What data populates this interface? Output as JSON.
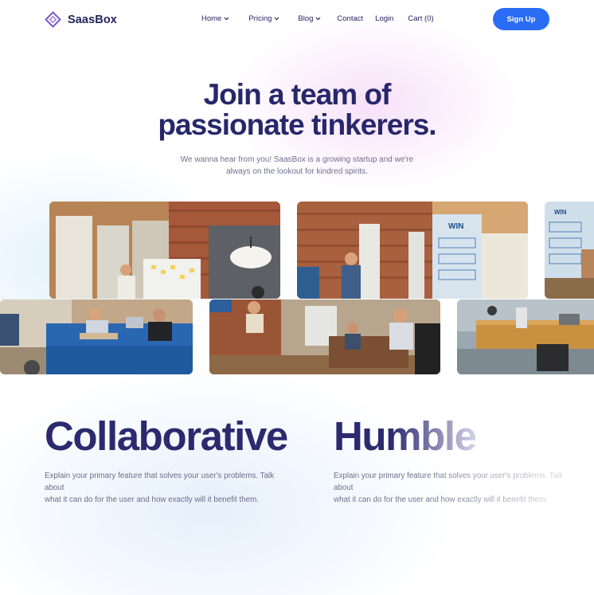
{
  "brand": {
    "name": "SaasBox",
    "accent": "#2a6df4",
    "text_color": "#27276b"
  },
  "nav": {
    "items": [
      {
        "label": "Home",
        "dropdown": true
      },
      {
        "label": "Pricing",
        "dropdown": true
      },
      {
        "label": "Blog",
        "dropdown": true
      },
      {
        "label": "Contact",
        "dropdown": false
      },
      {
        "label": "Login",
        "dropdown": false
      },
      {
        "label": "Cart (0)",
        "dropdown": false
      }
    ],
    "cta_label": "Sign Up"
  },
  "hero": {
    "title_line1": "Join a team of",
    "title_line2": "passionate tinkerers.",
    "subtitle_line1": "We wanna hear from you! SaasBox is a growing startup and we're",
    "subtitle_line2": "always on the lookout for kindred spirits."
  },
  "gallery": {
    "photos": [
      {
        "name": "office-photo-whiteboard-meeting"
      },
      {
        "name": "office-photo-presenter-win-wall"
      },
      {
        "name": "office-photo-win-wall-partial"
      },
      {
        "name": "office-photo-team-on-sofa"
      },
      {
        "name": "office-photo-lounge-discussion"
      },
      {
        "name": "office-photo-desk-workspace"
      }
    ]
  },
  "features": [
    {
      "title": "Collaborative",
      "description_line1": "Explain your primary feature that solves your user's problems. Talk about",
      "description_line2": "what it can do for the user and how exactly will it benefit them."
    },
    {
      "title": "Humble",
      "description_line1": "Explain your primary feature that solves your user's problems. Talk about",
      "description_line2": "what it can do for the user and how exactly will it benefit them."
    }
  ]
}
